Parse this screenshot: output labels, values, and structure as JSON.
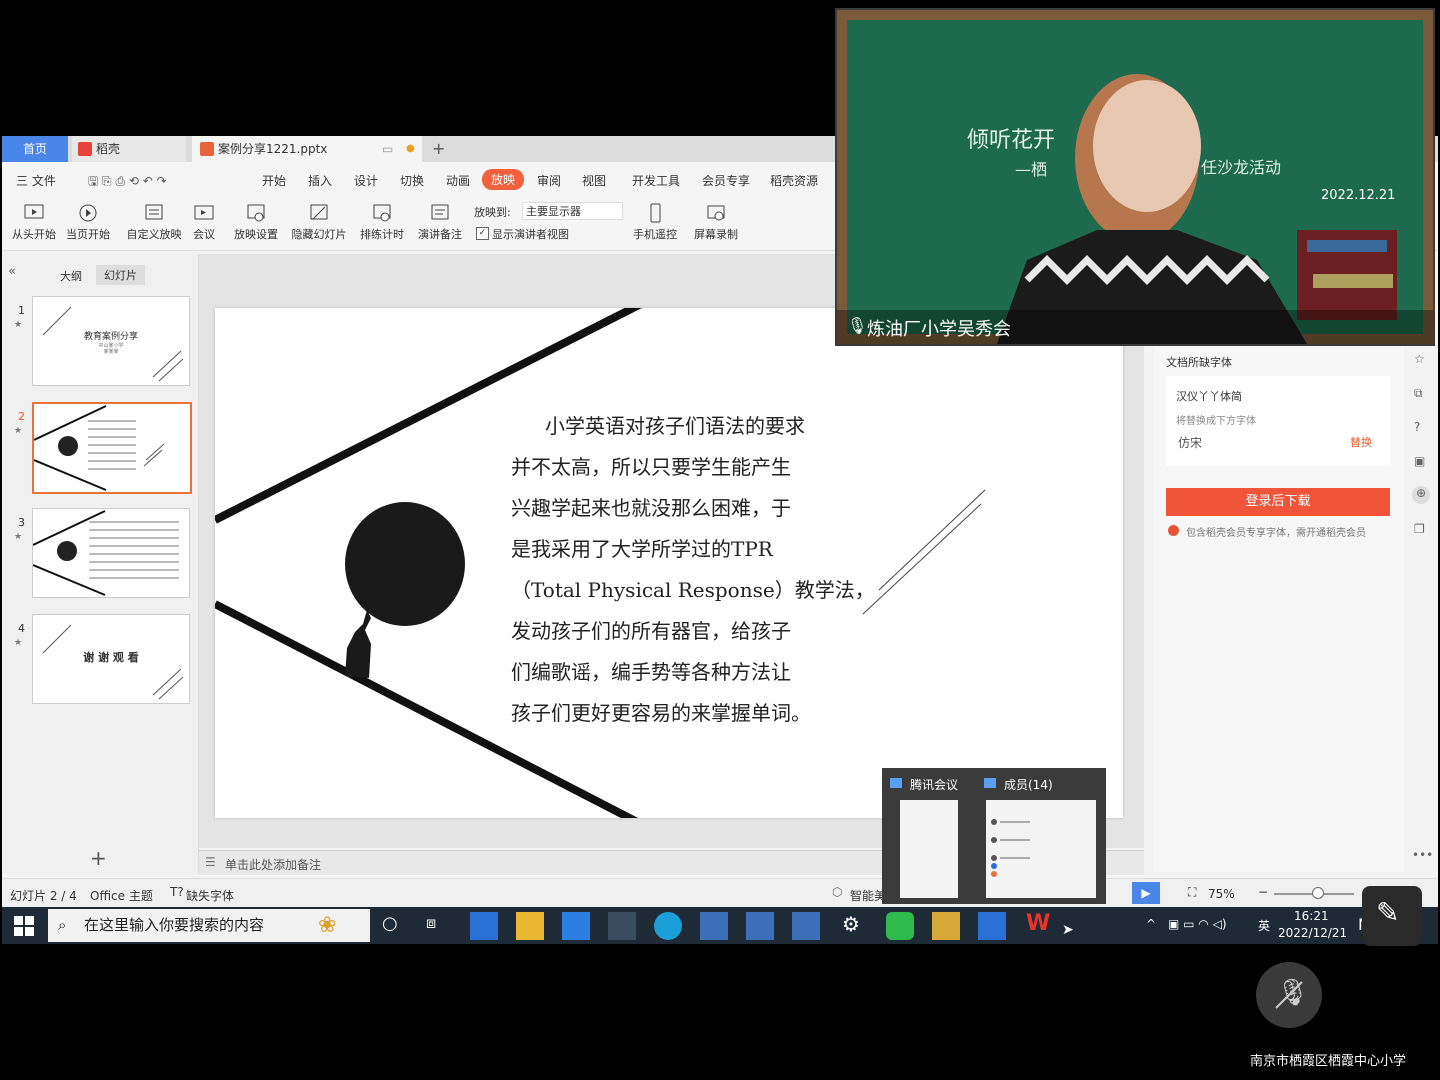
{
  "tabs": {
    "home": "首页",
    "daoke": "稻壳",
    "file": "案例分享1221.pptx",
    "add": "+"
  },
  "menu": {
    "file": "三 文件",
    "items": [
      "开始",
      "插入",
      "设计",
      "切换",
      "动画",
      "放映",
      "审阅",
      "视图",
      "开发工具",
      "会员专享",
      "稻壳资源"
    ],
    "active": "放映"
  },
  "ribbon": {
    "from_start": "从头开始",
    "from_current": "当页开始",
    "custom": "自定义放映",
    "meeting": "会议",
    "settings": "放映设置",
    "hide": "隐藏幻灯片",
    "rehearse": "排练计时",
    "notes": "演讲备注",
    "show_to_label": "放映到:",
    "show_to_value": "主要显示器",
    "presenter_view": "显示演讲者视图",
    "phone_remote": "手机遥控",
    "screen_record": "屏幕录制"
  },
  "leftpane": {
    "tab_outline": "大纲",
    "tab_slides": "幻灯片",
    "slides": [
      {
        "num": "1",
        "title": "教育案例分享",
        "sub1": "中山某小学",
        "sub2": "某某某"
      },
      {
        "num": "2"
      },
      {
        "num": "3"
      },
      {
        "num": "4",
        "title": "谢 谢 观 看"
      }
    ],
    "add": "+"
  },
  "slide": {
    "lines": [
      "小学英语对孩子们语法的要求",
      "并不太高，所以只要学生能产生",
      "兴趣学起来也就没那么困难，于",
      "是我采用了大学所学过的TPR",
      "（Total Physical Response）教学法，",
      "发动孩子们的所有器官，给孩子",
      "们编歌谣，编手势等各种方法让",
      "孩子们更好更容易的来掌握单词。"
    ]
  },
  "notes_placeholder": "单击此处添加备注",
  "status": {
    "slide": "幻灯片 2 / 4",
    "theme": "Office 主题",
    "missing_font": "缺失字体",
    "smart": "智能美",
    "zoom": "75%"
  },
  "rightpanel": {
    "title": "文档所缺字体",
    "font_name": "汉仪丫丫体简",
    "replace_hint": "将替换成下方字体",
    "replacement": "仿宋",
    "replace_btn": "替换",
    "download_btn": "登录后下载",
    "vip_note": "包含稻壳会员专享字体，需开通稻壳会员"
  },
  "video": {
    "speaker": "炼油厂小学吴秀会",
    "board_text1": "倾听花开",
    "board_text2": "—栖",
    "board_text3": "任沙龙活动",
    "board_date": "2022.12.21"
  },
  "popup": {
    "item1": "腾讯会议",
    "item2": "成员(14)"
  },
  "taskbar": {
    "search": "在这里输入你要搜索的内容",
    "time": "16:21",
    "date": "2022/12/21",
    "ime": "英"
  },
  "watermark": "南京市栖霞区栖霞中心小学",
  "colors": {
    "accent": "#f2603d",
    "tab_blue": "#4a86e8",
    "taskbar": "#1f2a37",
    "board_green": "#1d6a4e"
  }
}
